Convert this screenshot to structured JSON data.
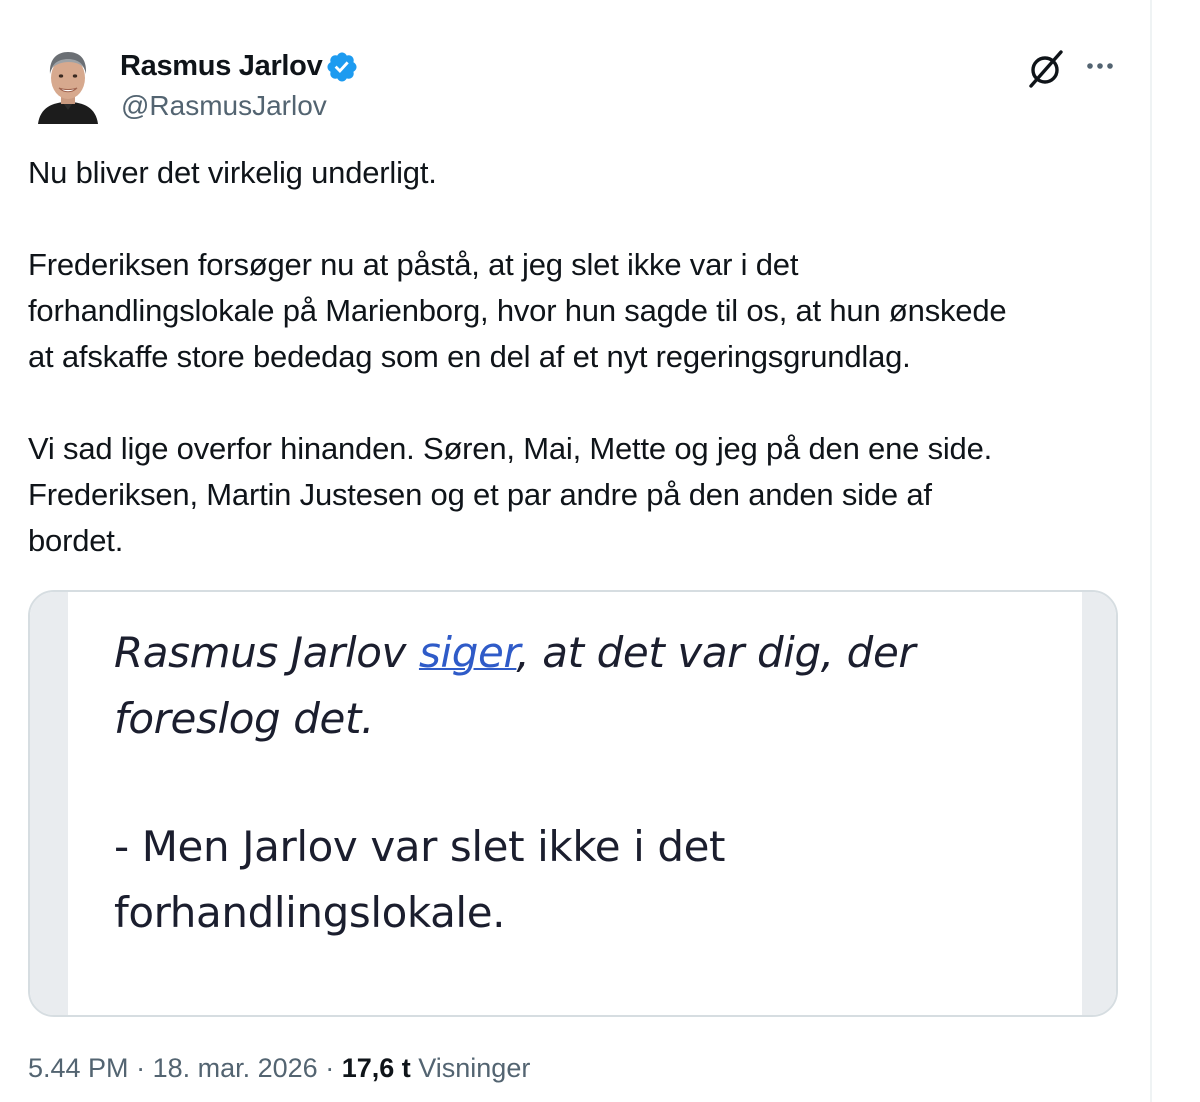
{
  "author": {
    "name": "Rasmus Jarlov",
    "handle": "@RasmusJarlov",
    "avatar": "profile-photo",
    "verified_badge": "verified-checkmark-icon",
    "verified_color": "#1d9bf0"
  },
  "header_icons": {
    "grok": "grok-icon",
    "more": "more-options-icon"
  },
  "tweet": {
    "paragraphs": [
      [
        "Nu bliver det virkelig underligt."
      ],
      [
        "Frederiksen forsøger nu at påstå, at jeg slet ikke var i det",
        "forhandlingslokale på Marienborg, hvor hun sagde til os, at hun ønskede",
        "at afskaffe store bededag som en del af et nyt regeringsgrundlag."
      ],
      [
        "Vi sad lige overfor hinanden. Søren, Mai, Mette og jeg på den ene side.",
        "Frederiksen, Martin Justesen og et par andre på den anden side af",
        "bordet."
      ]
    ]
  },
  "media": {
    "quote_line1_before": "Rasmus Jarlov ",
    "quote_link": "siger",
    "quote_line1_after": ", at det var dig, der",
    "quote_line2": "foreslog det.",
    "answer_line1": "- Men Jarlov var slet ikke i det",
    "answer_line2": "forhandlingslokale.",
    "link_color": "#2f5bc8"
  },
  "meta": {
    "time": "5.44 PM",
    "separator": " · ",
    "date": "18. mar. 2026",
    "views_count": "17,6 t",
    "views_label": "Visninger"
  }
}
